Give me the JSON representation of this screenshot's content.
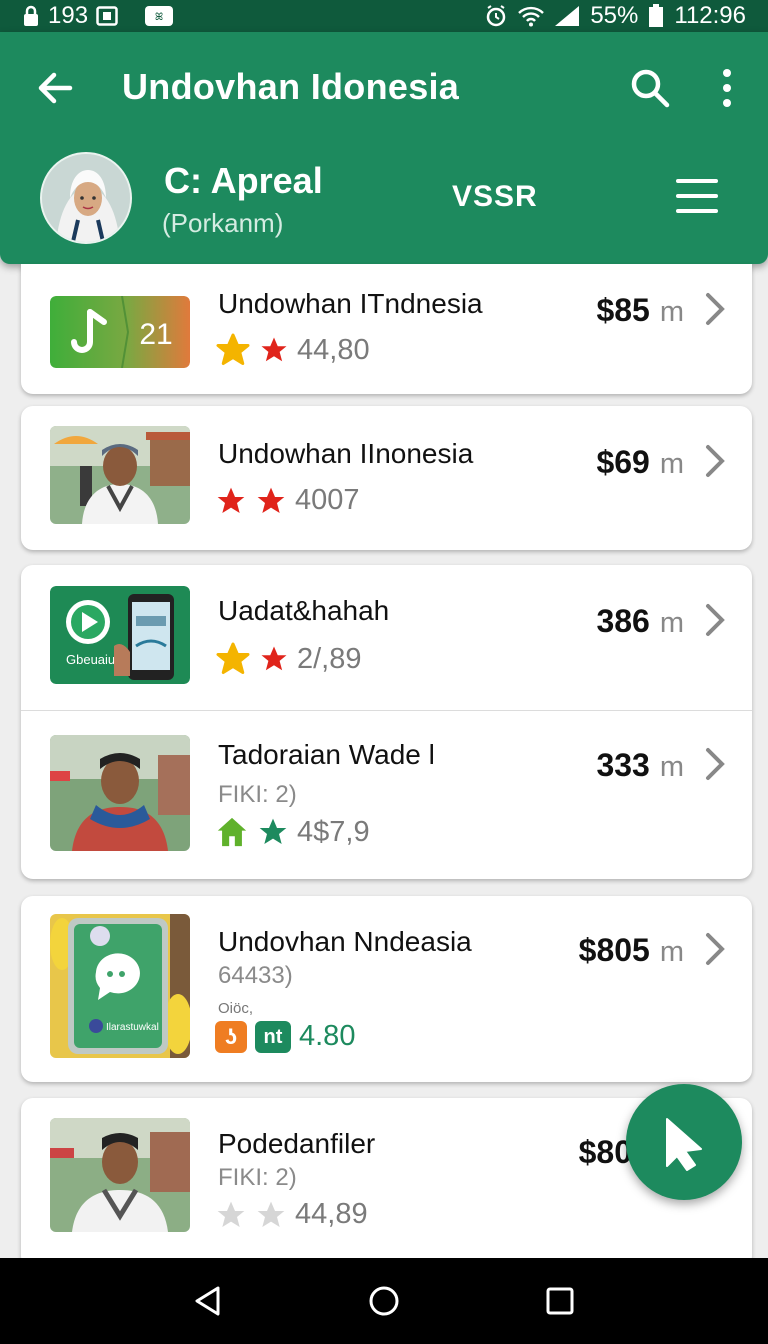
{
  "status_bar": {
    "left_text": "193",
    "battery": "55%",
    "time": "112:96"
  },
  "app_bar": {
    "title": "Undovhan Idonesia",
    "profile_name": "C: Apreal",
    "profile_sub": "(Porkanm)",
    "code": "VSSR"
  },
  "items": [
    {
      "title": "Undowhan ITndnesia",
      "rating": "44,80",
      "price": "$85",
      "unit": "m",
      "thumb_text": "21",
      "sub": ""
    },
    {
      "title": "Undowhan IInonesia",
      "rating": "4007",
      "price": "$69",
      "unit": "m",
      "sub": ""
    },
    {
      "title": "Uadat&hahah",
      "rating": "2/,89",
      "price": "386",
      "unit": "m",
      "thumb_text": "Gbeuaiu",
      "sub": ""
    },
    {
      "title": "Tadoraian Wade l",
      "sub": "FIKI: 2)",
      "rating": "4$7,9",
      "price": "333",
      "unit": "m"
    },
    {
      "title": "Undovhan Nndeasia",
      "sub": "64433)",
      "label": "Oiöc,",
      "rating": "4.80",
      "price": "$805",
      "unit": "m",
      "thumb_text": "Ilarastuwkal"
    },
    {
      "title": "Podedanfiler",
      "sub": "FIKI: 2)",
      "rating": "44,89",
      "price": "$80",
      "unit": ""
    }
  ],
  "colors": {
    "primary": "#1d8a5e",
    "status_bar": "#0f5a3c",
    "star_red": "#e0241b",
    "star_gold": "#f4b400",
    "star_green": "#1d8a5e",
    "star_grey": "#d0d0d0"
  },
  "icons": {
    "back": "arrow-left",
    "search": "magnifier",
    "more": "vertical-dots",
    "menu": "hamburger",
    "fab": "cursor-arrow",
    "nav": [
      "back-triangle",
      "home-circle",
      "recents-square"
    ]
  }
}
